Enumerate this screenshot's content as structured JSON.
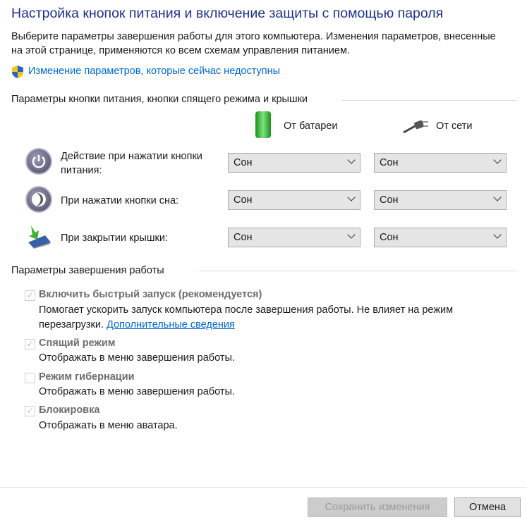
{
  "title": "Настройка кнопок питания и включение защиты с помощью пароля",
  "description": "Выберите параметры завершения работы для этого компьютера. Изменения параметров, внесенные на этой странице, применяются ко всем схемам управления питанием.",
  "change_link": "Изменение параметров, которые сейчас недоступны",
  "buttons_section": {
    "header": "Параметры кнопки питания, кнопки спящего режима и крышки",
    "battery_label": "От батареи",
    "ac_label": "От сети",
    "rows": [
      {
        "label": "Действие при нажатии кнопки питания:",
        "battery": "Сон",
        "ac": "Сон",
        "icon": "power-icon"
      },
      {
        "label": "При нажатии кнопки сна:",
        "battery": "Сон",
        "ac": "Сон",
        "icon": "sleep-icon"
      },
      {
        "label": "При закрытии крышки:",
        "battery": "Сон",
        "ac": "Сон",
        "icon": "laptop-lid-icon"
      }
    ]
  },
  "shutdown_section": {
    "header": "Параметры завершения работы",
    "items": [
      {
        "label": "Включить быстрый запуск (рекомендуется)",
        "checked": true,
        "desc": "Помогает ускорить запуск компьютера после завершения работы. Не влияет на режим перезагрузки.",
        "link": "Дополнительные сведения"
      },
      {
        "label": "Спящий режим",
        "checked": true,
        "desc": "Отображать в меню завершения работы."
      },
      {
        "label": "Режим гибернации",
        "checked": false,
        "desc": "Отображать в меню завершения работы."
      },
      {
        "label": "Блокировка",
        "checked": true,
        "desc": "Отображать в меню аватара."
      }
    ]
  },
  "footer": {
    "save": "Сохранить изменения",
    "cancel": "Отмена"
  }
}
